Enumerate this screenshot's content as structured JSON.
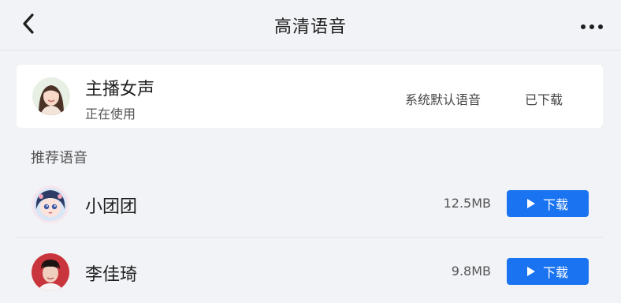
{
  "header": {
    "title": "高清语音",
    "back_icon": "chevron-left-icon",
    "more_icon": "more-horizontal-icon"
  },
  "current_voice": {
    "name": "主播女声",
    "status": "正在使用",
    "description": "系统默认语音",
    "download_state": "已下载"
  },
  "recommended": {
    "label": "推荐语音",
    "items": [
      {
        "name": "小团团",
        "size": "12.5MB",
        "button_label": "下载"
      },
      {
        "name": "李佳琦",
        "size": "9.8MB",
        "button_label": "下载"
      }
    ]
  },
  "colors": {
    "accent": "#1a73f0",
    "background": "#f2f3f6",
    "card": "#ffffff"
  }
}
